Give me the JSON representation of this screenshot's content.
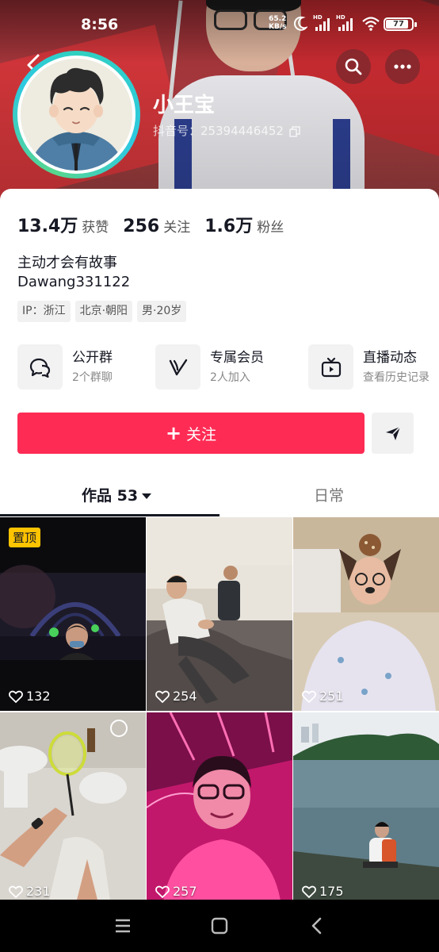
{
  "status_bar": {
    "time": "8:56",
    "net_speed_value": "65.2",
    "net_speed_unit": "KB/s",
    "signal_labels": [
      "HD",
      "HD"
    ],
    "battery": "77"
  },
  "profile": {
    "name": "小王宝",
    "douyin_id": "抖音号：25394446452",
    "stats": [
      {
        "num": "13.4万",
        "label": "获赞"
      },
      {
        "num": "256",
        "label": "关注"
      },
      {
        "num": "1.6万",
        "label": "粉丝"
      }
    ],
    "bio_line1": "主动才会有故事",
    "bio_line2": "Dawang331122",
    "tags": [
      "IP：浙江",
      "北京·朝阳",
      "男·20岁"
    ]
  },
  "features": [
    {
      "title": "公开群",
      "sub": "2个群聊",
      "icon": "group-chat-icon"
    },
    {
      "title": "专属会员",
      "sub": "2人加入",
      "icon": "vip-v-icon"
    },
    {
      "title": "直播动态",
      "sub": "查看历史记录",
      "icon": "live-tv-icon"
    }
  ],
  "actions": {
    "follow_label": "关注",
    "share_icon": "send-arrow-icon"
  },
  "tabs": {
    "works_label": "作品 53",
    "daily_label": "日常"
  },
  "videos": [
    {
      "likes": "132",
      "pinned": "置顶"
    },
    {
      "likes": "254"
    },
    {
      "likes": "251"
    },
    {
      "likes": "231"
    },
    {
      "likes": "257"
    },
    {
      "likes": "175"
    }
  ],
  "colors": {
    "accent": "#fe2c55",
    "pin_badge": "#ffc300",
    "avatar_ring": "#30d0c0"
  }
}
